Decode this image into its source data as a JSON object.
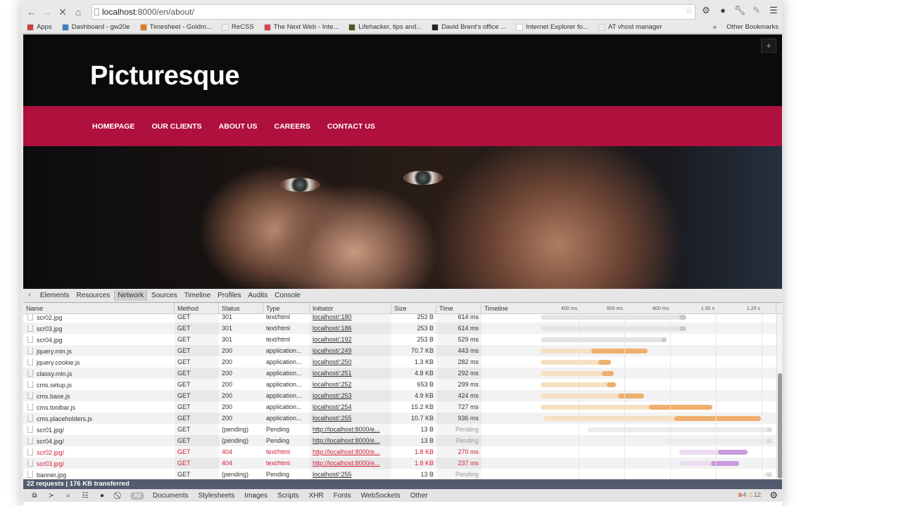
{
  "browser": {
    "url_host": "localhost",
    "url_rest": ":8000/en/about/",
    "bookmarks": [
      {
        "label": "Apps",
        "color": "#d04040"
      },
      {
        "label": "Dashboard - gw20e",
        "color": "#3a7fc8"
      },
      {
        "label": "Timesheet - Goldm...",
        "color": "#e07a20"
      },
      {
        "label": "ReCSS",
        "color": "#eeeeee"
      },
      {
        "label": "The Next Web - Inte...",
        "color": "#e04050"
      },
      {
        "label": "Lifehacker, tips and...",
        "color": "#4a5a20"
      },
      {
        "label": "David Brent's office ...",
        "color": "#222222"
      },
      {
        "label": "Internet Explorer fo...",
        "color": "#ffffff"
      },
      {
        "label": "AT vhost manager",
        "color": "#eeeeee"
      }
    ],
    "overflow": "»",
    "other_bookmarks": "Other Bookmarks"
  },
  "site": {
    "logo": "Picturesque",
    "plus": "+",
    "nav": [
      "HOMEPAGE",
      "OUR CLIENTS",
      "ABOUT US",
      "CAREERS",
      "CONTACT US"
    ],
    "brand_color": "#b0103e"
  },
  "devtools": {
    "tabs": [
      "Elements",
      "Resources",
      "Network",
      "Sources",
      "Timeline",
      "Profiles",
      "Audits",
      "Console"
    ],
    "active_tab": "Network",
    "columns": [
      "Name",
      "Method",
      "Status",
      "Type",
      "Initiator",
      "Size",
      "Time",
      "Timeline"
    ],
    "timeline_ticks": [
      "400 ms",
      "600 ms",
      "800 ms",
      "1.00 s",
      "1.20 s"
    ],
    "rows": [
      {
        "name": "scr02.jpg",
        "method": "GET",
        "status": "301",
        "type": "text/html",
        "initiator": "localhost/:180",
        "size": "253 B",
        "time": "614 ms",
        "bar": [
          234,
          840,
          871
        ],
        "kind": "gray"
      },
      {
        "name": "scr03.jpg",
        "method": "GET",
        "status": "301",
        "type": "text/html",
        "initiator": "localhost/:186",
        "size": "253 B",
        "time": "614 ms",
        "bar": [
          234,
          840,
          871
        ],
        "kind": "gray"
      },
      {
        "name": "scr04.jpg",
        "method": "GET",
        "status": "301",
        "type": "text/html",
        "initiator": "localhost/:192",
        "size": "253 B",
        "time": "529 ms",
        "bar": [
          234,
          763,
          785
        ],
        "kind": "gray"
      },
      {
        "name": "jquery.min.js",
        "method": "GET",
        "status": "200",
        "type": "application...",
        "initiator": "localhost/:249",
        "size": "70.7 KB",
        "time": "443 ms",
        "bar": [
          234,
          455,
          702
        ],
        "kind": "orange"
      },
      {
        "name": "jquery.cookie.js",
        "method": "GET",
        "status": "200",
        "type": "application...",
        "initiator": "localhost/:250",
        "size": "1.3 KB",
        "time": "282 ms",
        "bar": [
          234,
          486,
          542
        ],
        "kind": "orange"
      },
      {
        "name": "classy.min.js",
        "method": "GET",
        "status": "200",
        "type": "application...",
        "initiator": "localhost/:251",
        "size": "4.8 KB",
        "time": "292 ms",
        "bar": [
          234,
          502,
          554
        ],
        "kind": "orange"
      },
      {
        "name": "cms.setup.js",
        "method": "GET",
        "status": "200",
        "type": "application...",
        "initiator": "localhost/:252",
        "size": "653 B",
        "time": "299 ms",
        "bar": [
          234,
          523,
          563
        ],
        "kind": "orange"
      },
      {
        "name": "cms.base.js",
        "method": "GET",
        "status": "200",
        "type": "application...",
        "initiator": "localhost/:253",
        "size": "4.9 KB",
        "time": "424 ms",
        "bar": [
          234,
          572,
          686
        ],
        "kind": "orange"
      },
      {
        "name": "cms.toolbar.js",
        "method": "GET",
        "status": "200",
        "type": "application...",
        "initiator": "localhost/:254",
        "size": "15.2 KB",
        "time": "727 ms",
        "bar": [
          234,
          708,
          985
        ],
        "kind": "orange"
      },
      {
        "name": "cms.placeholders.js",
        "method": "GET",
        "status": "200",
        "type": "application...",
        "initiator": "localhost/:255",
        "size": "10.7 KB",
        "time": "936 ms",
        "bar": [
          246,
          818,
          1197
        ],
        "kind": "orange"
      },
      {
        "name": "scr01.jpg/",
        "method": "GET",
        "status": "(pending)",
        "type": "Pending",
        "initiator": "http://localhost:8000/e...",
        "size": "13 B",
        "time": "Pending",
        "bar": [
          440,
          1240,
          1240
        ],
        "kind": "pending"
      },
      {
        "name": "scr04.jpg/",
        "method": "GET",
        "status": "(pending)",
        "type": "Pending",
        "initiator": "http://localhost:8000/e...",
        "size": "13 B",
        "time": "Pending",
        "bar": [
          763,
          1240,
          1240
        ],
        "kind": "pending"
      },
      {
        "name": "scr02.jpg/",
        "method": "GET",
        "status": "404",
        "type": "text/html",
        "initiator": "http://localhost:8000/e...",
        "size": "1.8 KB",
        "time": "270 ms",
        "bar": [
          840,
          1009,
          1138
        ],
        "kind": "error"
      },
      {
        "name": "scr03.jpg/",
        "method": "GET",
        "status": "404",
        "type": "text/html",
        "initiator": "http://localhost:8000/e...",
        "size": "1.8 KB",
        "time": "237 ms",
        "bar": [
          840,
          978,
          1102
        ],
        "kind": "error"
      },
      {
        "name": "banner.jpg",
        "method": "GET",
        "status": "(pending)",
        "type": "Pending",
        "initiator": "localhost/:255",
        "size": "13 B",
        "time": "Pending",
        "bar": [
          1209,
          1240,
          1240
        ],
        "kind": "pending"
      }
    ],
    "summary": "22 requests  |  176 KB transferred",
    "filters": [
      "All",
      "Documents",
      "Stylesheets",
      "Images",
      "Scripts",
      "XHR",
      "Fonts",
      "WebSockets",
      "Other"
    ],
    "errors": "4",
    "warnings": "12"
  }
}
